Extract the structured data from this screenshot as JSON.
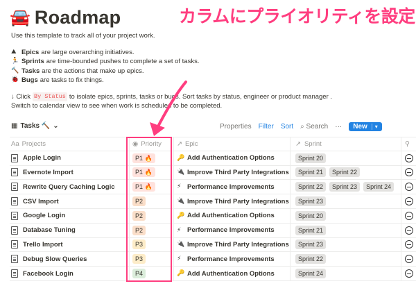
{
  "page": {
    "title_emoji": "🚘",
    "title": "Roadmap",
    "intro": "Use this template to track all of your project work.",
    "defs": [
      {
        "icon": "⛰",
        "term": "Epics",
        "text": "are large overarching initiatives."
      },
      {
        "icon": "🏃",
        "term": "Sprints",
        "text": "are time-bounded pushes to complete a set of tasks."
      },
      {
        "icon": "🔨",
        "term": "Tasks",
        "text": "are the actions that make up epics."
      },
      {
        "icon": "🐞",
        "term": "Bugs",
        "text": "are tasks to fix things."
      }
    ],
    "click_prefix": "↓ Click",
    "click_code": "By Status",
    "click_suffix": "to isolate epics, sprints, tasks or bugs. Sort tasks by status, engineer or product manager .",
    "switch_line": "Switch to calendar view to see when work is scheduled to be completed."
  },
  "callout": {
    "text": "カラムにプライオリティを設定",
    "color": "#ff3d7f"
  },
  "toolbar": {
    "view_label": "Tasks 🔨",
    "properties": "Properties",
    "filter": "Filter",
    "sort": "Sort",
    "search": "Search",
    "more": "···",
    "new": "New"
  },
  "columns": {
    "name": "Projects",
    "priority": "Priority",
    "epic": "Epic",
    "sprint": "Sprint"
  },
  "rows": [
    {
      "name": "Apple Login",
      "priority": "P1 🔥",
      "pclass": "p1",
      "epic_icon": "🔑",
      "epic": "Add Authentication Options",
      "sprints": [
        "Sprint 20"
      ]
    },
    {
      "name": "Evernote Import",
      "priority": "P1 🔥",
      "pclass": "p1",
      "epic_icon": "🔌",
      "epic": "Improve Third Party Integrations",
      "sprints": [
        "Sprint 21",
        "Sprint 22"
      ]
    },
    {
      "name": "Rewrite Query Caching Logic",
      "priority": "P1 🔥",
      "pclass": "p1",
      "epic_icon": "⚡",
      "epic": "Performance Improvements",
      "sprints": [
        "Sprint 22",
        "Sprint 23",
        "Sprint 24"
      ]
    },
    {
      "name": "CSV Import",
      "priority": "P2",
      "pclass": "p2",
      "epic_icon": "🔌",
      "epic": "Improve Third Party Integrations",
      "sprints": [
        "Sprint 23"
      ]
    },
    {
      "name": "Google Login",
      "priority": "P2",
      "pclass": "p2",
      "epic_icon": "🔑",
      "epic": "Add Authentication Options",
      "sprints": [
        "Sprint 20"
      ]
    },
    {
      "name": "Database Tuning",
      "priority": "P2",
      "pclass": "p2",
      "epic_icon": "⚡",
      "epic": "Performance Improvements",
      "sprints": [
        "Sprint 21"
      ]
    },
    {
      "name": "Trello Import",
      "priority": "P3",
      "pclass": "p3",
      "epic_icon": "🔌",
      "epic": "Improve Third Party Integrations",
      "sprints": [
        "Sprint 23"
      ]
    },
    {
      "name": "Debug Slow Queries",
      "priority": "P3",
      "pclass": "p3",
      "epic_icon": "⚡",
      "epic": "Performance Improvements",
      "sprints": [
        "Sprint 22"
      ]
    },
    {
      "name": "Facebook Login",
      "priority": "P4",
      "pclass": "p4",
      "epic_icon": "🔑",
      "epic": "Add Authentication Options",
      "sprints": [
        "Sprint 24"
      ]
    }
  ]
}
